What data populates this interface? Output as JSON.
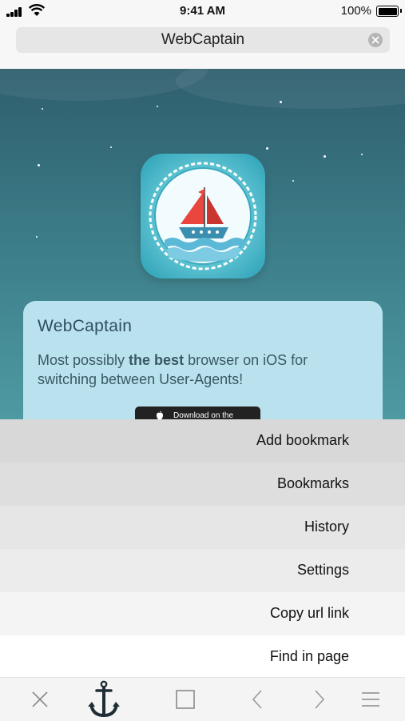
{
  "status": {
    "time": "9:41 AM",
    "battery": "100%"
  },
  "address_bar": {
    "title": "WebCaptain"
  },
  "page": {
    "card_title": "WebCaptain",
    "desc_pre": "Most possibly ",
    "desc_bold": "the best",
    "desc_post": " browser on iOS for switching between User-Agents!",
    "store_button": "Download on the"
  },
  "menu": {
    "items": [
      {
        "label": "Add bookmark",
        "bg": "#d8d8d8"
      },
      {
        "label": "Bookmarks",
        "bg": "#dedede"
      },
      {
        "label": "History",
        "bg": "#e6e6e6"
      },
      {
        "label": "Settings",
        "bg": "#ececec"
      },
      {
        "label": "Copy url link",
        "bg": "#f4f4f4"
      },
      {
        "label": "Find in page",
        "bg": "#ffffff"
      }
    ]
  },
  "toolbar": {
    "icons": [
      "close-icon",
      "anchor-icon",
      "tabs-icon",
      "back-icon",
      "forward-icon",
      "menu-icon"
    ]
  }
}
